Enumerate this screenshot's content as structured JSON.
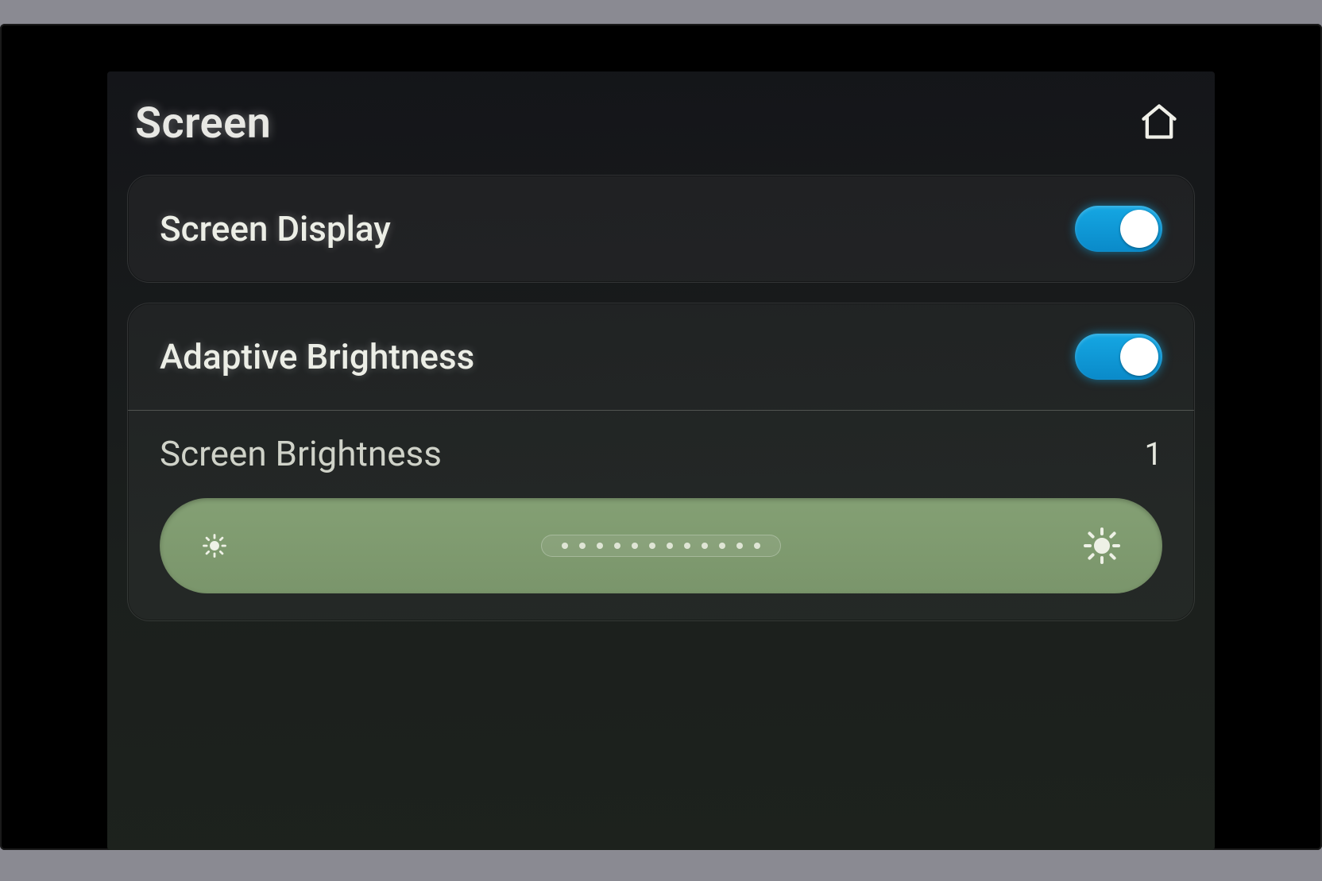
{
  "header": {
    "title": "Screen",
    "home_icon": "home-icon"
  },
  "settings": {
    "display": {
      "label": "Screen Display",
      "enabled": true
    },
    "adaptive": {
      "label": "Adaptive Brightness",
      "enabled": true
    },
    "brightness": {
      "label": "Screen Brightness",
      "value": "1"
    }
  },
  "colors": {
    "toggle_on": "#0fa0dc",
    "slider_bg": "#7f9a6f"
  }
}
